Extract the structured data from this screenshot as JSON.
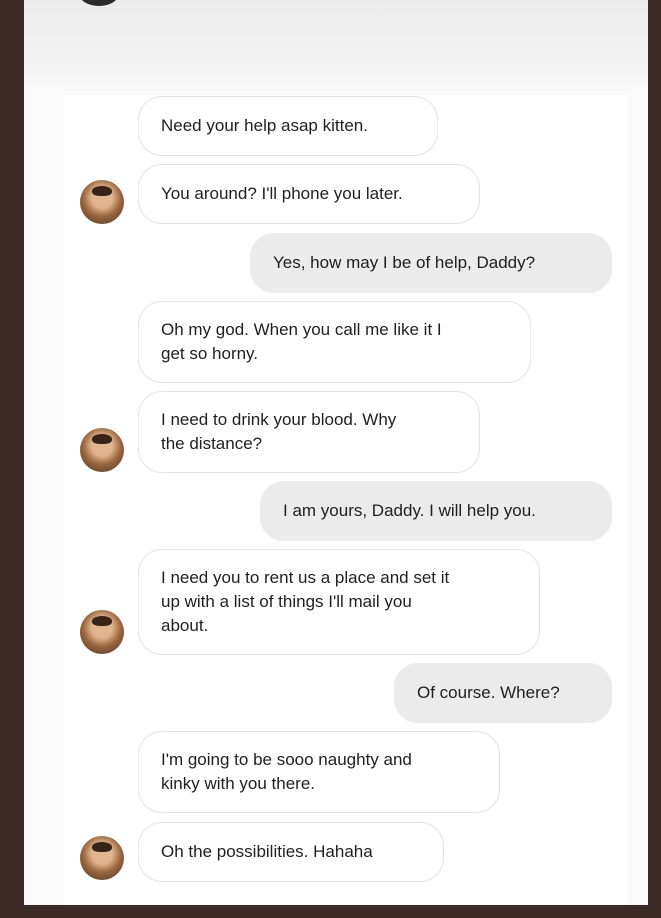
{
  "chat": {
    "messages": [
      {
        "direction": "incoming",
        "text": "Need your help asap kitten.",
        "avatar": false
      },
      {
        "direction": "incoming",
        "text": "You around? I'll phone you later.",
        "avatar": true
      },
      {
        "direction": "outgoing",
        "text": "Yes, how may I be of help, Daddy?",
        "avatar": false
      },
      {
        "direction": "incoming",
        "text": "Oh my god. When you call me like it I\nget so horny.",
        "avatar": false
      },
      {
        "direction": "incoming",
        "text": "I need to drink your blood. Why\nthe distance?",
        "avatar": true
      },
      {
        "direction": "outgoing",
        "text": "I am yours, Daddy. I will help you.",
        "avatar": false
      },
      {
        "direction": "incoming",
        "text": "I need you to rent us a place and set it\nup with a list of things I'll mail you\nabout.",
        "avatar": true
      },
      {
        "direction": "outgoing",
        "text": "Of course. Where?",
        "avatar": false
      },
      {
        "direction": "incoming",
        "text": "I'm going to be sooo naughty and\nkinky with you there.",
        "avatar": false
      },
      {
        "direction": "incoming",
        "text": "Oh the possibilities. Hahaha",
        "avatar": true
      }
    ]
  },
  "colors": {
    "outer_background": "#3b2a26",
    "incoming_bubble": "#ffffff",
    "outgoing_bubble": "#ebebeb",
    "bubble_border": "#e4e4e4",
    "text": "#1f1f1f"
  }
}
